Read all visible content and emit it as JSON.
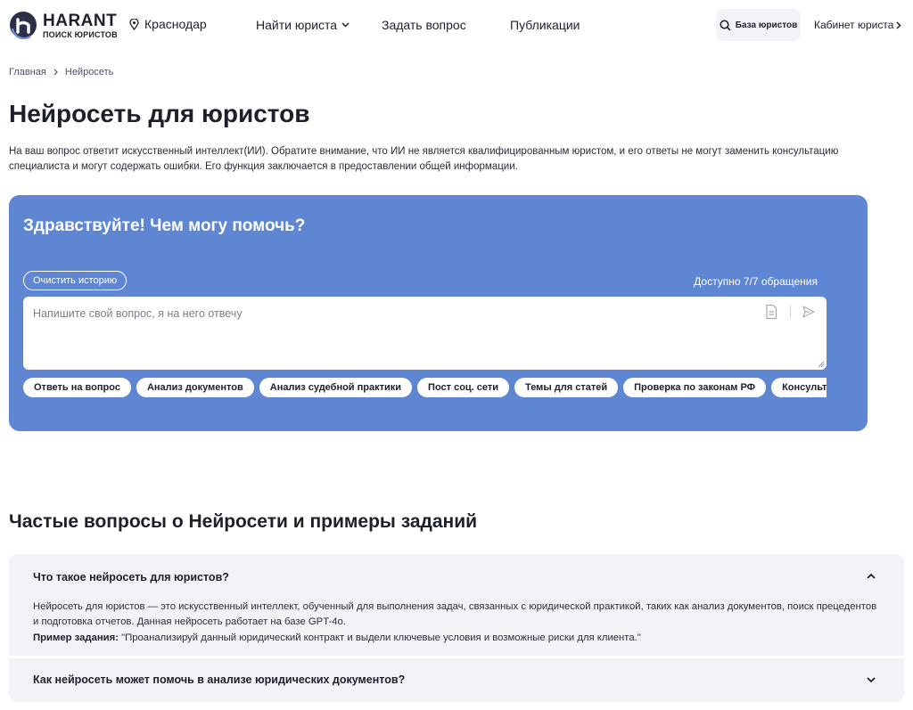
{
  "header": {
    "logo_name": "HARANT",
    "logo_sub": "ПОИСК ЮРИСТОВ",
    "city": "Краснодар",
    "nav": {
      "find_lawyer": "Найти юриста",
      "ask_question": "Задать вопрос",
      "publications": "Публикации"
    },
    "search_button": "База юристов",
    "cabinet": "Кабинет юриста"
  },
  "breadcrumb": {
    "home": "Главная",
    "current": "Нейросеть"
  },
  "page": {
    "title": "Нейросеть для юристов",
    "intro": "На ваш вопрос ответит искусственный интеллект(ИИ). Обратите внимание, что ИИ не является квалифицированным юристом, и его ответы не могут заменить консультацию специалиста и могут содержать ошибки. Его функция заключается в предоставлении общей информации."
  },
  "chat": {
    "greeting": "Здравствуйте! Чем могу помочь?",
    "clear_history": "Очистить историю",
    "quota": "Доступно 7/7 обращения",
    "input_placeholder": "Напишите свой вопрос, я на него отвечу",
    "input_value": "",
    "chips": [
      "Ответь на вопрос",
      "Анализ документов",
      "Анализ судебной практики",
      "Пост соц. сети",
      "Темы для статей",
      "Проверка по законам РФ",
      "Консультации по закону"
    ]
  },
  "faq": {
    "title": "Частые вопросы о Нейросети и примеры заданий",
    "items": [
      {
        "question": "Что такое нейросеть для юристов?",
        "answer": "Нейросеть для юристов — это искусственный интеллект, обученный для выполнения задач, связанных с юридической практикой, таких как анализ документов, поиск прецедентов и подготовка отчетов. Данная нейросеть работает на базе GPT-4o.",
        "example_label": "Пример задания:",
        "example_text": " \"Проанализируй данный юридический контракт и выдели ключевые условия и возможные риски для клиента.\"",
        "expanded": true
      },
      {
        "question": "Как нейросеть может помочь в анализе юридических документов?",
        "expanded": false
      }
    ]
  },
  "colors": {
    "accent": "#5f86d3",
    "text": "#1d1f2b",
    "muted_bg": "#f2f3f6"
  },
  "icons": {
    "logo": "harant-logo-icon",
    "city": "location-pin-icon",
    "nav_dropdown": "chevron-down-icon",
    "search": "search-icon",
    "cabinet": "chevron-right-icon",
    "attach": "document-icon",
    "send": "send-icon",
    "faq_open": "chevron-up-icon",
    "faq_closed": "chevron-down-icon"
  }
}
